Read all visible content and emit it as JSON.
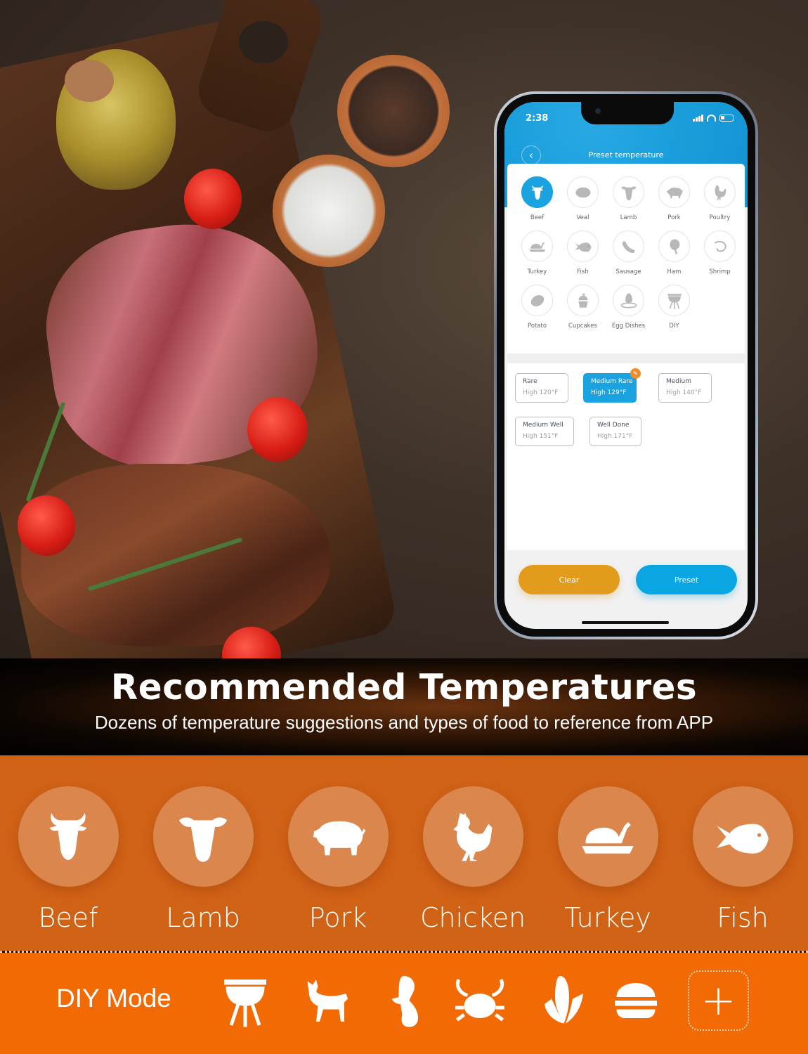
{
  "phone": {
    "status_time": "2:38",
    "app_title": "Preset temperature",
    "foods": [
      {
        "label": "Beef",
        "icon": "cow-head-icon",
        "selected": true
      },
      {
        "label": "Veal",
        "icon": "steak-icon",
        "selected": false
      },
      {
        "label": "Lamb",
        "icon": "sheep-head-icon",
        "selected": false
      },
      {
        "label": "Pork",
        "icon": "pig-icon",
        "selected": false
      },
      {
        "label": "Poultry",
        "icon": "chicken-icon",
        "selected": false
      },
      {
        "label": "Turkey",
        "icon": "roast-turkey-icon",
        "selected": false
      },
      {
        "label": "Fish",
        "icon": "fish-icon",
        "selected": false
      },
      {
        "label": "Sausage",
        "icon": "sausage-icon",
        "selected": false
      },
      {
        "label": "Ham",
        "icon": "ham-icon",
        "selected": false
      },
      {
        "label": "Shrimp",
        "icon": "shrimp-icon",
        "selected": false
      },
      {
        "label": "Potato",
        "icon": "potato-icon",
        "selected": false
      },
      {
        "label": "Cupcakes",
        "icon": "cupcake-icon",
        "selected": false
      },
      {
        "label": "Egg Dishes",
        "icon": "egg-icon",
        "selected": false
      },
      {
        "label": "DIY",
        "icon": "grill-icon",
        "selected": false
      }
    ],
    "doneness": [
      {
        "name": "Rare",
        "value": "High 120°F",
        "selected": false
      },
      {
        "name": "Medium Rare",
        "value": "High 129°F",
        "selected": true
      },
      {
        "name": "Medium",
        "value": "High 140°F",
        "selected": false
      },
      {
        "name": "Medium Well",
        "value": "High 151°F",
        "selected": false
      },
      {
        "name": "Well Done",
        "value": "High 171°F",
        "selected": false
      }
    ],
    "clear_label": "Clear",
    "preset_label": "Preset",
    "colors": {
      "accent": "#1aa3e0",
      "clear": "#e39b1d",
      "edit_badge": "#f08d2a"
    }
  },
  "banner": {
    "title": "Recommended Temperatures",
    "subtitle": "Dozens of temperature suggestions and types of food to reference from APP"
  },
  "categories": [
    {
      "label": "Beef",
      "icon": "cow-head-icon"
    },
    {
      "label": "Lamb",
      "icon": "sheep-head-icon"
    },
    {
      "label": "Pork",
      "icon": "pig-icon"
    },
    {
      "label": "Chicken",
      "icon": "chicken-icon"
    },
    {
      "label": "Turkey",
      "icon": "roast-turkey-icon"
    },
    {
      "label": "Fish",
      "icon": "fish-icon"
    }
  ],
  "diy": {
    "label": "DIY Mode",
    "icons": [
      "grill-icon",
      "goat-icon",
      "duck-icon",
      "crab-icon",
      "corn-icon",
      "burger-icon"
    ],
    "add_symbol": "+"
  },
  "colors": {
    "category_bg": "#d06216",
    "circle_bg": "#db864c",
    "diy_bg": "#f26a03"
  }
}
